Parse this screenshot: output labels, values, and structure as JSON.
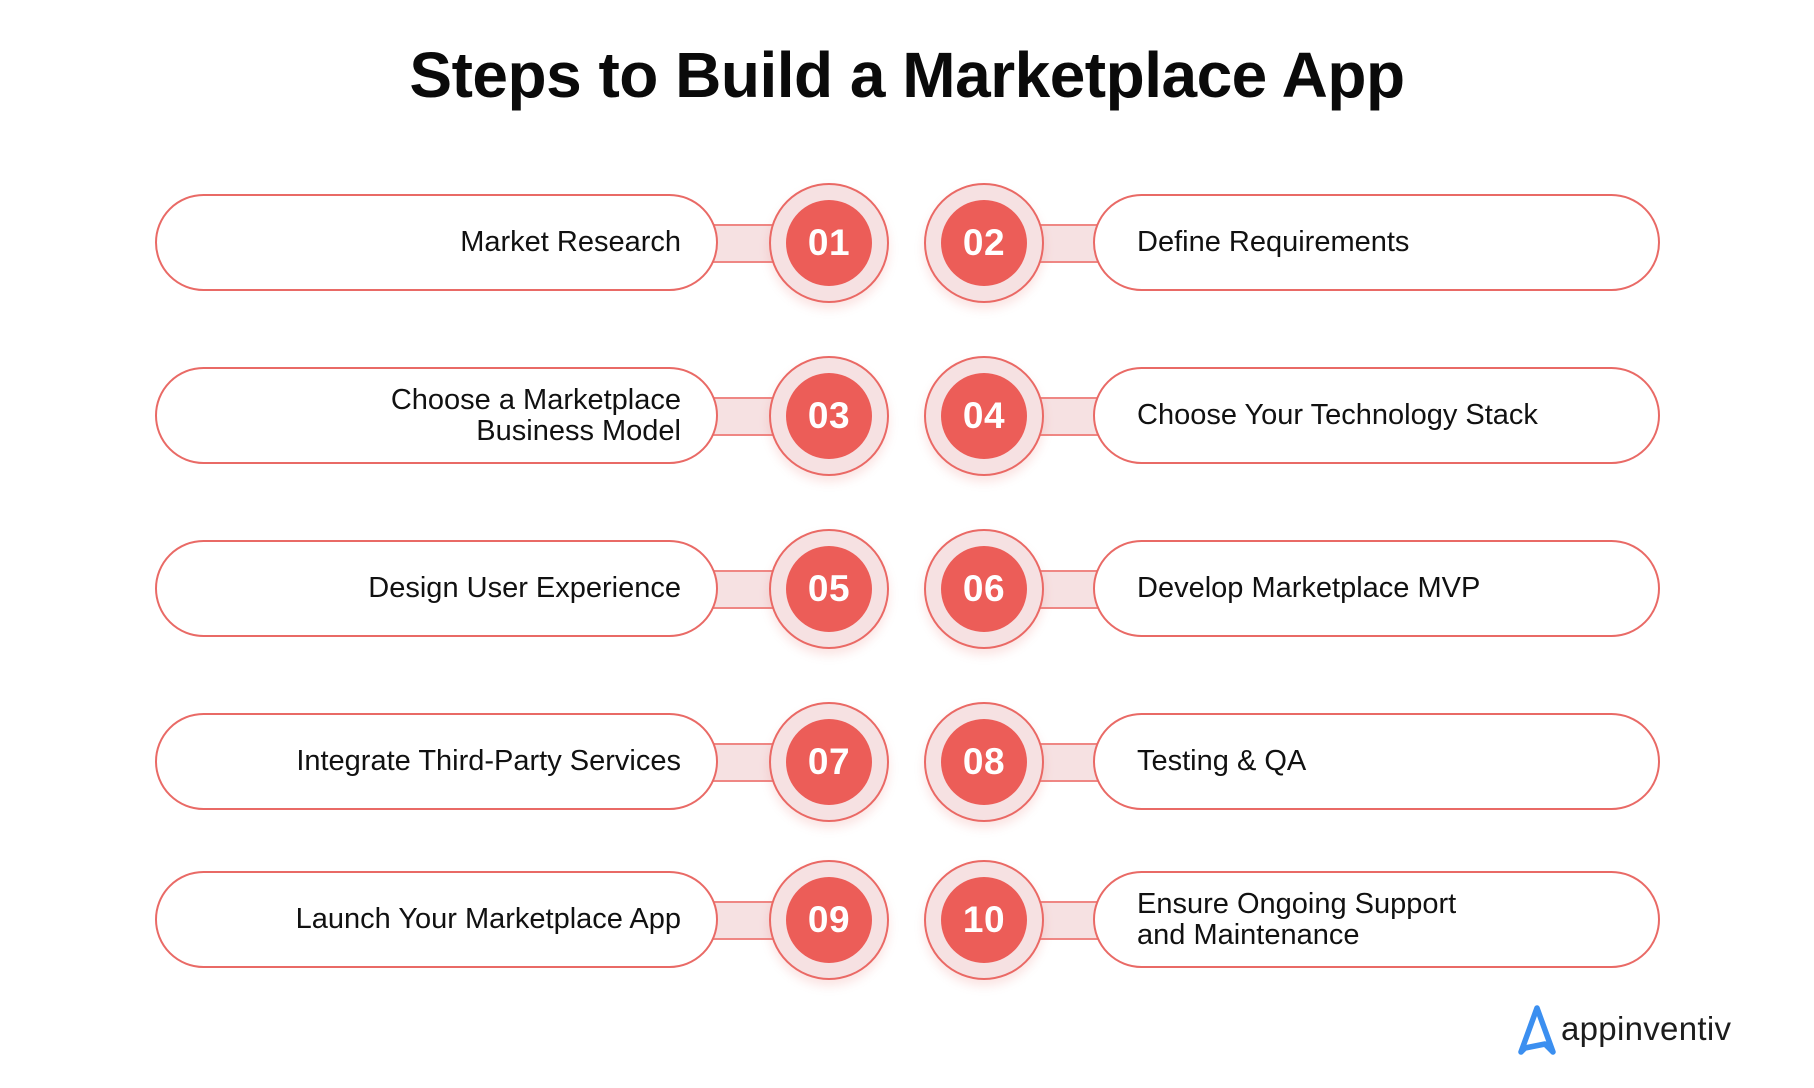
{
  "title": "Steps to Build a Marketplace App",
  "accent_color": "#ec5d58",
  "ring_fill_color": "#f6e1e2",
  "steps": [
    {
      "number": "01",
      "label": "Market Research"
    },
    {
      "number": "02",
      "label": "Define Requirements"
    },
    {
      "number": "03",
      "label": "Choose a Marketplace\nBusiness Model"
    },
    {
      "number": "04",
      "label": "Choose Your Technology Stack"
    },
    {
      "number": "05",
      "label": "Design User Experience"
    },
    {
      "number": "06",
      "label": "Develop Marketplace MVP"
    },
    {
      "number": "07",
      "label": "Integrate Third-Party Services"
    },
    {
      "number": "08",
      "label": "Testing & QA"
    },
    {
      "number": "09",
      "label": "Launch Your Marketplace App"
    },
    {
      "number": "10",
      "label": "Ensure Ongoing Support\nand Maintenance"
    }
  ],
  "logo": {
    "icon": "appinventiv-a-icon",
    "text": "appinventiv",
    "color": "#3b8ff0"
  }
}
